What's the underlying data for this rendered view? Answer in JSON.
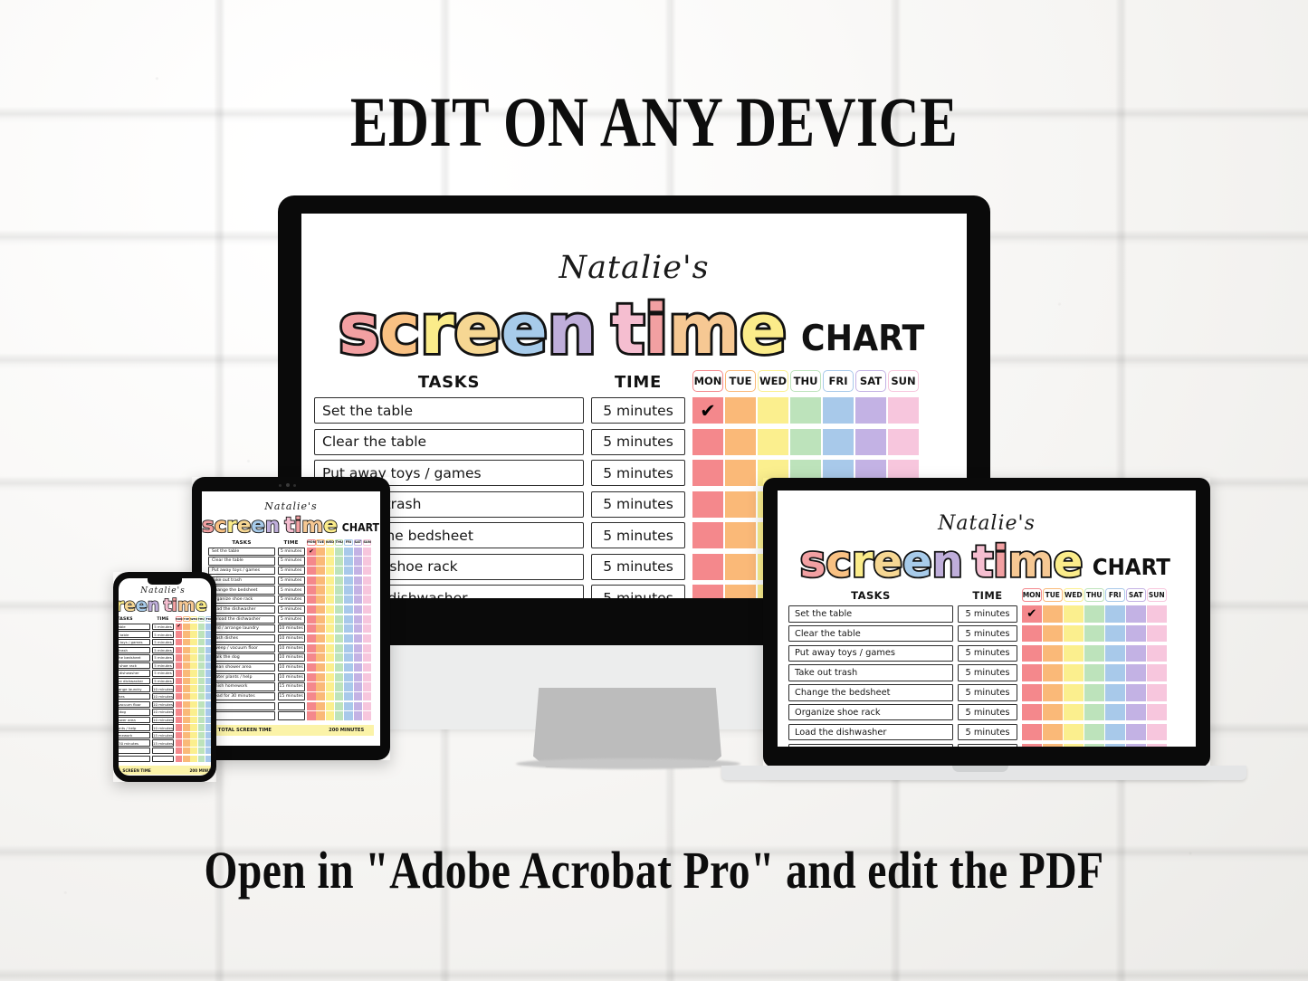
{
  "banner": {
    "top": "EDIT ON ANY DEVICE",
    "bottom": "Open in \"Adobe Acrobat Pro\" and edit the PDF"
  },
  "chart": {
    "owner_name": "Natalie's",
    "title_letters": [
      {
        "ch": "s",
        "color": "#f2a0a2"
      },
      {
        "ch": "c",
        "color": "#f9c183"
      },
      {
        "ch": "r",
        "color": "#fbec8a"
      },
      {
        "ch": "e",
        "color": "#f6d793"
      },
      {
        "ch": "e",
        "color": "#a7cbea"
      },
      {
        "ch": "n",
        "color": "#bfaeda"
      }
    ],
    "title_letters2": [
      {
        "ch": "t",
        "color": "#f5bed0"
      },
      {
        "ch": "i",
        "color": "#f2a0a2"
      },
      {
        "ch": "m",
        "color": "#f6c893"
      },
      {
        "ch": "e",
        "color": "#fbec8a"
      }
    ],
    "title_suffix": "CHART",
    "col_tasks": "TASKS",
    "col_time": "TIME",
    "days": [
      {
        "label": "MON",
        "color": "#f4888c"
      },
      {
        "label": "TUE",
        "color": "#fab978"
      },
      {
        "label": "WED",
        "color": "#fbef8e"
      },
      {
        "label": "THU",
        "color": "#bde3bb"
      },
      {
        "label": "FRI",
        "color": "#a8c9ea"
      },
      {
        "label": "SAT",
        "color": "#c3b2e4"
      },
      {
        "label": "SUN",
        "color": "#f7c6dd"
      }
    ],
    "checkmark": "✔",
    "checked_row": 0,
    "checked_day": 0,
    "rows": [
      {
        "task": "Set the table",
        "time": "5 minutes"
      },
      {
        "task": "Clear the table",
        "time": "5 minutes"
      },
      {
        "task": "Put away toys / games",
        "time": "5 minutes"
      },
      {
        "task": "Take out trash",
        "time": "5 minutes"
      },
      {
        "task": "Change the bedsheet",
        "time": "5 minutes"
      },
      {
        "task": "Organize shoe rack",
        "time": "5 minutes"
      },
      {
        "task": "Load the dishwasher",
        "time": "5 minutes"
      },
      {
        "task": "Unload the dishwasher",
        "time": "5 minutes"
      },
      {
        "task": "Fold / arrange laundry",
        "time": "10 minutes"
      },
      {
        "task": "Wash dishes",
        "time": "10 minutes"
      },
      {
        "task": "Sweep / vacuum floor",
        "time": "10 minutes"
      },
      {
        "task": "Walk the dog",
        "time": "10 minutes"
      },
      {
        "task": "Clean shower area",
        "time": "10 minutes"
      },
      {
        "task": "Water plants / help",
        "time": "10 minutes"
      },
      {
        "task": "Finish homework",
        "time": "15 minutes"
      },
      {
        "task": "Read for 30 minutes",
        "time": "15 minutes"
      },
      {
        "task": "",
        "time": ""
      },
      {
        "task": "",
        "time": ""
      }
    ],
    "total_label": "TOTAL SCREEN TIME",
    "total_value": "200 MINUTES"
  }
}
